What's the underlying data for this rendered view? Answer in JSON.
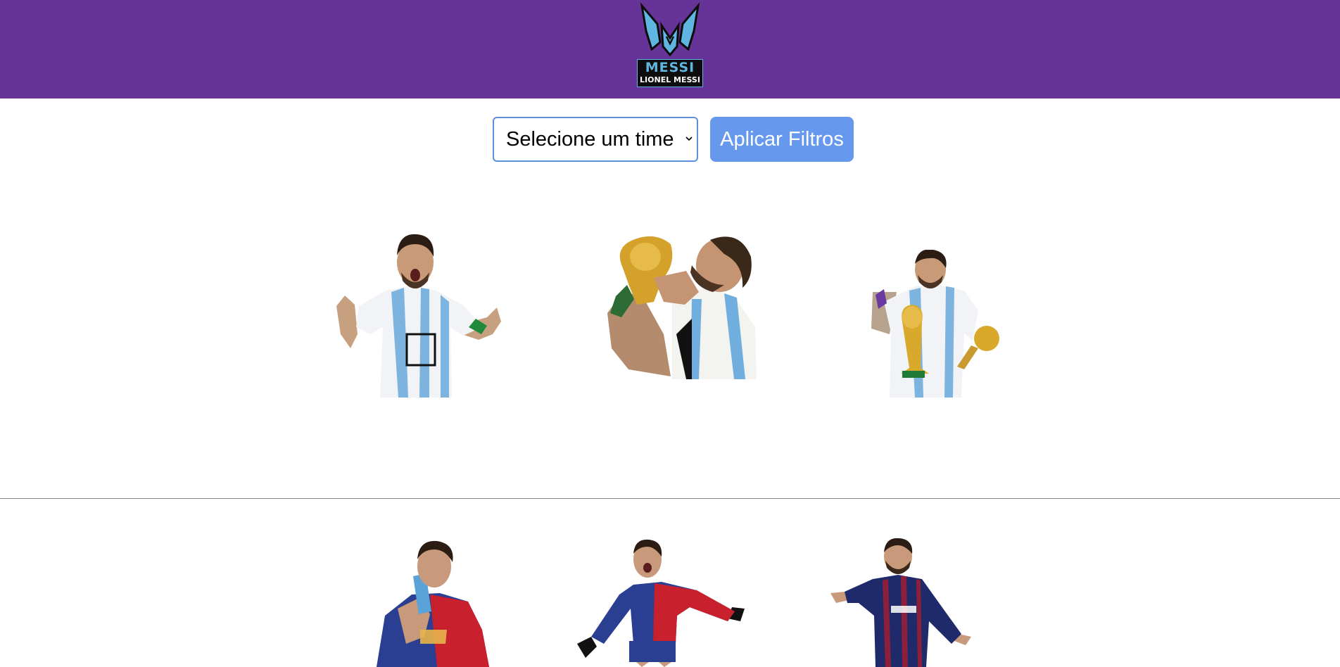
{
  "header": {
    "logo": {
      "title": "MESSI",
      "subtitle": "LIONEL MESSI",
      "icon": "messi-m-logo"
    },
    "colors": {
      "background": "#663399",
      "logo_accent": "#5fb6e0"
    }
  },
  "filters": {
    "team_select": {
      "selected": "Selecione um time"
    },
    "apply_button": {
      "label": "Aplicar Filtros"
    },
    "colors": {
      "button": "#6699ee",
      "select_border": "#5b8fd9"
    }
  },
  "gallery": {
    "sections": [
      {
        "team": "argentina",
        "items": [
          "messi-celebrating-argentina",
          "messi-kissing-world-cup-trophy",
          "messi-holding-trophy-and-golden-ball"
        ]
      },
      {
        "team": "barcelona",
        "items": [
          "messi-kissing-barcelona-badge",
          "messi-running-celebration-barcelona",
          "messi-pointing-barcelona"
        ]
      }
    ]
  }
}
